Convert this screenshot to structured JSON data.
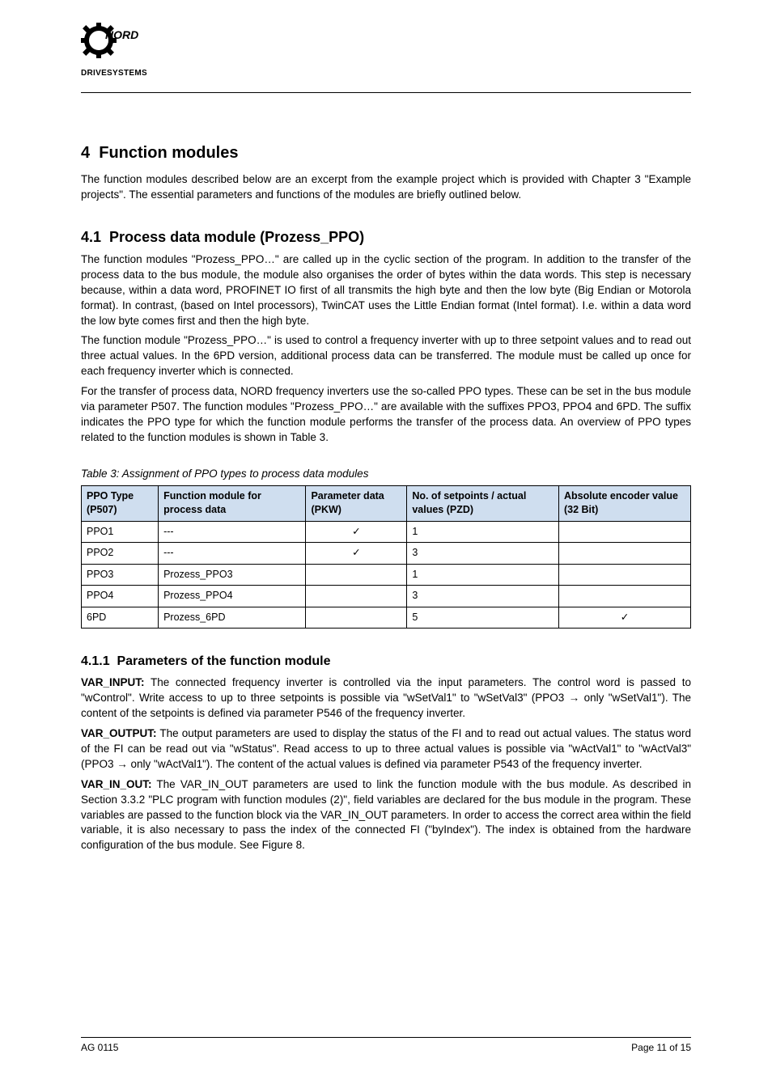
{
  "logo_tag": "DRIVESYSTEMS",
  "section": {
    "num": "4",
    "title": "Function modules",
    "para1": "The function modules described below are an excerpt from the example project which is provided with Chapter 3 \"Example projects\". The essential parameters and functions of the modules are briefly outlined below.",
    "h_sub_num": "4.1",
    "h_sub_title": "Process data module (Prozess_PPO)",
    "para_sub1": "The function modules \"Prozess_PPO…\" are called up in the cyclic section of the program. In addition to the transfer of the process data to the bus module, the module also organises the order of bytes within the data words. This step is necessary because, within a data word, PROFINET IO first of all transmits the high byte and then the low byte (Big Endian or Motorola format). In contrast, (based on Intel processors), TwinCAT uses the Little Endian format (Intel format). I.e. within a data word the low byte comes first and then the high byte.",
    "para_sub2": "The function module \"Prozess_PPO…\" is used to control a frequency inverter with up to three setpoint values and to read out three actual values. In the 6PD version, additional process data can be transferred. The module must be called up once for each frequency inverter which is connected.",
    "para_sub3": "For the transfer of process data, NORD frequency inverters use the so-called PPO types. These can be set in the bus module via parameter P507. The function modules \"Prozess_PPO…\" are available with the suffixes PPO3, PPO4 and 6PD. The suffix indicates the PPO type for which the function module performs the transfer of the process data. An overview of PPO types related to the function modules is shown in Table 3.",
    "table_caption": "Table 3: Assignment of PPO types to process data modules",
    "table": {
      "headers": [
        "PPO Type (P507)",
        "Function module for process data",
        "Parameter data (PKW)",
        "No. of setpoints / actual values (PZD)",
        "Absolute encoder value (32 Bit)"
      ],
      "rows": [
        [
          "PPO1",
          "---",
          "✓",
          "1",
          ""
        ],
        [
          "PPO2",
          "---",
          "✓",
          "3",
          ""
        ],
        [
          "PPO3",
          "Prozess_PPO3",
          "",
          "1",
          ""
        ],
        [
          "PPO4",
          "Prozess_PPO4",
          "",
          "3",
          ""
        ],
        [
          "6PD",
          "Prozess_6PD",
          "",
          "5",
          "✓"
        ]
      ]
    },
    "h_sub2_num": "4.1.1",
    "h_sub2_title": "Parameters of the function module",
    "para_fun1_lead": "VAR_INPUT:",
    "para_fun1_body": " The connected frequency inverter is controlled via the input parameters. The control word is passed to \"wControl\". Write access to up to three setpoints is possible via \"wSetVal1\" to \"wSetVal3\" (PPO3 → only \"wSetVal1\"). The content of the setpoints is defined via parameter P546 of the frequency inverter.",
    "para_fun2_lead": "VAR_OUTPUT:",
    "para_fun2_body": " The output parameters are used to display the status of the FI and to read out actual values. The status word of the FI can be read out via \"wStatus\". Read access to up to three actual values is possible via \"wActVal1\" to \"wActVal3\" (PPO3 → only \"wActVal1\"). The content of the actual values is defined via parameter P543 of the frequency inverter.",
    "para_fun3_lead": "VAR_IN_OUT:",
    "para_fun3_body": " The VAR_IN_OUT parameters are used to link the function module with the bus module. As described in Section 3.3.2 \"PLC program with function modules (2)\", field variables are declared for the bus module in the program. These variables are passed to the function block via the VAR_IN_OUT parameters. In order to access the correct area within the field variable, it is also necessary to pass the index of the connected FI (\"byIndex\"). The index is obtained from the hardware configuration of the bus module. See Figure 8."
  },
  "footer": {
    "left": "AG 0115",
    "right": "Page 11 of 15"
  }
}
